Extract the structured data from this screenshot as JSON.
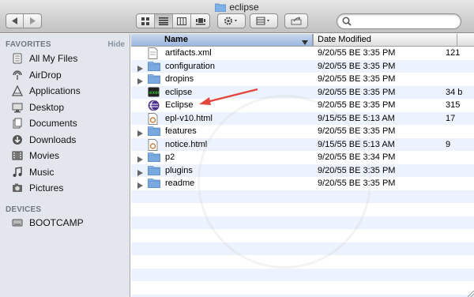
{
  "window": {
    "title": "eclipse",
    "icon": "folder-icon"
  },
  "toolbar": {
    "back_icon": "back-arrow-icon",
    "forward_icon": "forward-arrow-icon",
    "view_modes": [
      "icon-view",
      "list-view",
      "column-view",
      "coverflow-view"
    ],
    "selected_view": "list-view",
    "action_icon": "gear-icon",
    "arrange_icon": "arrange-icon",
    "share_icon": "share-icon",
    "search_placeholder": ""
  },
  "sidebar": {
    "favorites_label": "FAVORITES",
    "hide_label": "Hide",
    "favorites": [
      {
        "label": "All My Files",
        "icon": "all-files-icon"
      },
      {
        "label": "AirDrop",
        "icon": "airdrop-icon"
      },
      {
        "label": "Applications",
        "icon": "applications-icon"
      },
      {
        "label": "Desktop",
        "icon": "desktop-icon"
      },
      {
        "label": "Documents",
        "icon": "documents-icon"
      },
      {
        "label": "Downloads",
        "icon": "downloads-icon"
      },
      {
        "label": "Movies",
        "icon": "movies-icon"
      },
      {
        "label": "Music",
        "icon": "music-icon"
      },
      {
        "label": "Pictures",
        "icon": "pictures-icon"
      }
    ],
    "devices_label": "DEVICES",
    "devices": [
      {
        "label": "BOOTCAMP",
        "icon": "drive-icon"
      }
    ]
  },
  "list": {
    "columns": {
      "name": "Name",
      "date": "Date Modified"
    },
    "rows": [
      {
        "name": "artifacts.xml",
        "date": "9/20/55 BE 3:35 PM",
        "size": "121",
        "kind": "doc",
        "expandable": false
      },
      {
        "name": "configuration",
        "date": "9/20/55 BE 3:35 PM",
        "size": "",
        "kind": "folder",
        "expandable": true
      },
      {
        "name": "dropins",
        "date": "9/20/55 BE 3:35 PM",
        "size": "",
        "kind": "folder",
        "expandable": true
      },
      {
        "name": "eclipse",
        "date": "9/20/55 BE 3:35 PM",
        "size": "34 b",
        "kind": "exec",
        "expandable": false
      },
      {
        "name": "Eclipse",
        "date": "9/20/55 BE 3:35 PM",
        "size": "315",
        "kind": "app",
        "expandable": false
      },
      {
        "name": "epl-v10.html",
        "date": "9/15/55 BE 5:13 AM",
        "size": "17",
        "kind": "html",
        "expandable": false
      },
      {
        "name": "features",
        "date": "9/20/55 BE 3:35 PM",
        "size": "",
        "kind": "folder",
        "expandable": true
      },
      {
        "name": "notice.html",
        "date": "9/15/55 BE 5:13 AM",
        "size": "9",
        "kind": "html",
        "expandable": false
      },
      {
        "name": "p2",
        "date": "9/20/55 BE 3:34 PM",
        "size": "",
        "kind": "folder",
        "expandable": true
      },
      {
        "name": "plugins",
        "date": "9/20/55 BE 3:35 PM",
        "size": "",
        "kind": "folder",
        "expandable": true
      },
      {
        "name": "readme",
        "date": "9/20/55 BE 3:35 PM",
        "size": "",
        "kind": "folder",
        "expandable": true
      }
    ]
  },
  "annotation": {
    "arrow_color": "#e3473d",
    "points_to": "Eclipse"
  },
  "colors": {
    "row_alt": "#edf3fe",
    "sidebar_bg": "#e3e7ed",
    "folder": "#6f9fd8"
  }
}
